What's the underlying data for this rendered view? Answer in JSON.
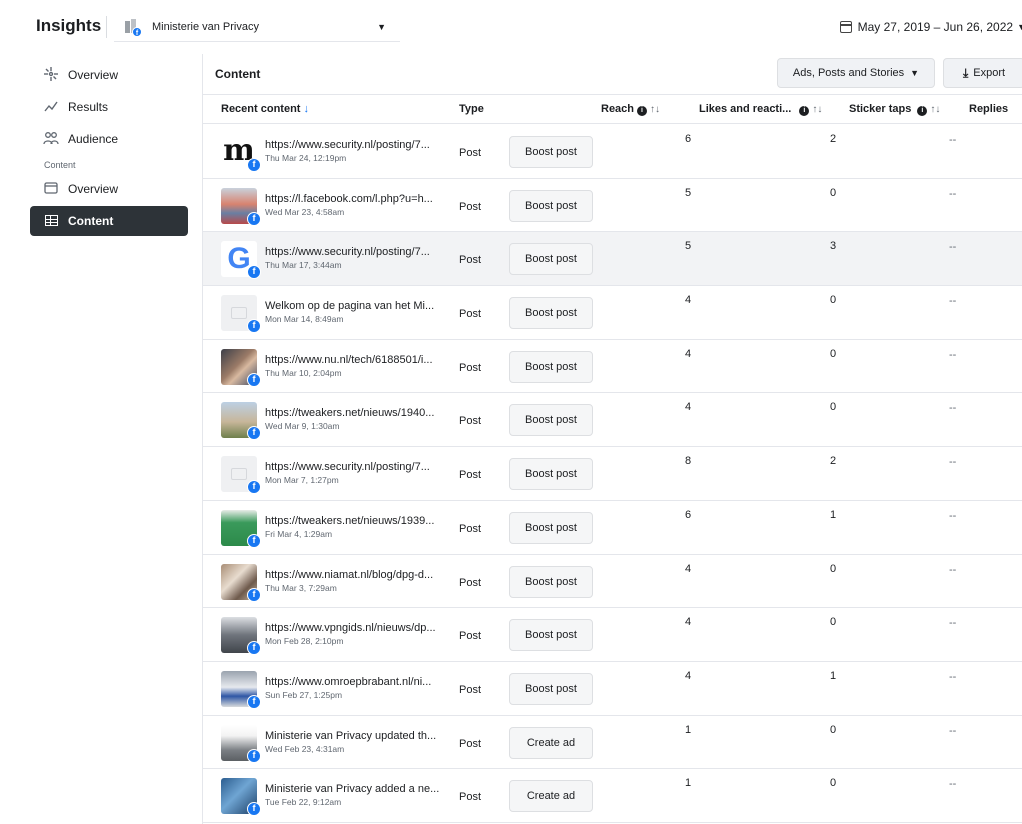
{
  "header": {
    "brand": "Insights",
    "page_name": "Ministerie van Privacy",
    "date_range": "May 27, 2019 – Jun 26, 2022"
  },
  "sidebar": {
    "items_top": [
      {
        "label": "Overview",
        "icon": "sparkle-icon"
      },
      {
        "label": "Results",
        "icon": "trend-icon"
      },
      {
        "label": "Audience",
        "icon": "people-icon"
      }
    ],
    "section_label": "Content",
    "items_content": [
      {
        "label": "Overview",
        "icon": "image-icon"
      },
      {
        "label": "Content",
        "icon": "table-icon",
        "active": true
      }
    ]
  },
  "content": {
    "title": "Content",
    "filter_label": "Ads, Posts and Stories",
    "export_label": "Export",
    "columns": {
      "recent": "Recent content",
      "type": "Type",
      "reach": "Reach",
      "likes": "Likes and reacti...",
      "sticker": "Sticker taps",
      "replies": "Replies"
    },
    "rows": [
      {
        "title": "https://www.security.nl/posting/7...",
        "date": "Thu Mar 24, 12:19pm",
        "type": "Post",
        "action": "Boost post",
        "reach": "6",
        "likes": "2",
        "sticker": "--",
        "thumb": "t-m"
      },
      {
        "title": "https://l.facebook.com/l.php?u=h...",
        "date": "Wed Mar 23, 4:58am",
        "type": "Post",
        "action": "Boost post",
        "reach": "5",
        "likes": "0",
        "sticker": "--",
        "thumb": "t-photo1"
      },
      {
        "title": "https://www.security.nl/posting/7...",
        "date": "Thu Mar 17, 3:44am",
        "type": "Post",
        "action": "Boost post",
        "reach": "5",
        "likes": "3",
        "sticker": "--",
        "thumb": "t-g",
        "highlight": true
      },
      {
        "title": "Welkom op de pagina van het Mi...",
        "date": "Mon Mar 14, 8:49am",
        "type": "Post",
        "action": "Boost post",
        "reach": "4",
        "likes": "0",
        "sticker": "--",
        "thumb": "t-blank"
      },
      {
        "title": "https://www.nu.nl/tech/6188501/i...",
        "date": "Thu Mar 10, 2:04pm",
        "type": "Post",
        "action": "Boost post",
        "reach": "4",
        "likes": "0",
        "sticker": "--",
        "thumb": "t-face"
      },
      {
        "title": "https://tweakers.net/nieuws/1940...",
        "date": "Wed Mar 9, 1:30am",
        "type": "Post",
        "action": "Boost post",
        "reach": "4",
        "likes": "0",
        "sticker": "--",
        "thumb": "t-build"
      },
      {
        "title": "https://www.security.nl/posting/7...",
        "date": "Mon Mar 7, 1:27pm",
        "type": "Post",
        "action": "Boost post",
        "reach": "8",
        "likes": "2",
        "sticker": "--",
        "thumb": "t-blank"
      },
      {
        "title": "https://tweakers.net/nieuws/1939...",
        "date": "Fri Mar 4, 1:29am",
        "type": "Post",
        "action": "Boost post",
        "reach": "6",
        "likes": "1",
        "sticker": "--",
        "thumb": "t-kasp"
      },
      {
        "title": "https://www.niamat.nl/blog/dpg-d...",
        "date": "Thu Mar 3, 7:29am",
        "type": "Post",
        "action": "Boost post",
        "reach": "4",
        "likes": "0",
        "sticker": "--",
        "thumb": "t-people"
      },
      {
        "title": "https://www.vpngids.nl/nieuws/dp...",
        "date": "Mon Feb 28, 2:10pm",
        "type": "Post",
        "action": "Boost post",
        "reach": "4",
        "likes": "0",
        "sticker": "--",
        "thumb": "t-tower"
      },
      {
        "title": "https://www.omroepbrabant.nl/ni...",
        "date": "Sun Feb 27, 1:25pm",
        "type": "Post",
        "action": "Boost post",
        "reach": "4",
        "likes": "1",
        "sticker": "--",
        "thumb": "t-police"
      },
      {
        "title": "Ministerie van Privacy updated th...",
        "date": "Wed Feb 23, 4:31am",
        "type": "Post",
        "action": "Create ad",
        "reach": "1",
        "likes": "0",
        "sticker": "--",
        "thumb": "t-cityline"
      },
      {
        "title": "Ministerie van Privacy added a ne...",
        "date": "Tue Feb 22, 9:12am",
        "type": "Post",
        "action": "Create ad",
        "reach": "1",
        "likes": "0",
        "sticker": "--",
        "thumb": "t-glass"
      }
    ]
  }
}
